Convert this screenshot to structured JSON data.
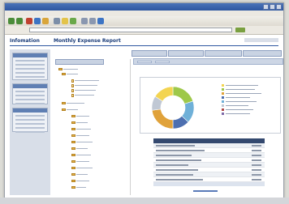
{
  "report": {
    "title": "Monthly Expense Report"
  },
  "chart_data": {
    "type": "pie",
    "donut": true,
    "categories": [
      "",
      "",
      "",
      "",
      "",
      ""
    ],
    "values": [
      20,
      17,
      13,
      23,
      11,
      16
    ],
    "colors": [
      "#9ec84a",
      "#6fb0d8",
      "#4d6fb0",
      "#e0a23a",
      "#c0c8d4",
      "#f3d451"
    ]
  },
  "legend": {
    "colors": [
      "#f3d451",
      "#9ec84a",
      "#e0a23a",
      "#4d6fb0",
      "#6fb0d8",
      "#c0c8d4",
      "#b04a4a",
      "#7e6aa8"
    ]
  },
  "grid": {
    "rows": 8
  }
}
